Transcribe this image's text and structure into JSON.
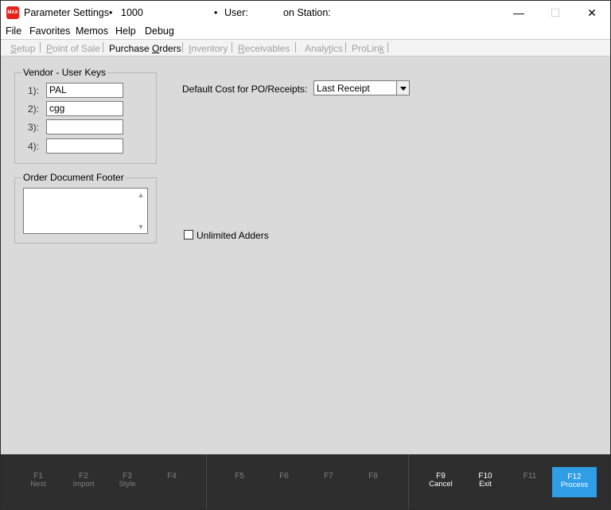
{
  "window": {
    "app_icon": "MAX",
    "title": "Parameter Settings",
    "bullet1": "•",
    "store_number": "1000",
    "bullet2": "•",
    "user_label": "User:",
    "station_label": "on Station:",
    "controls": {
      "minimize": "—",
      "maximize": "☐",
      "close": "✕"
    }
  },
  "menu": [
    "File",
    "Favorites",
    "Memos",
    "Help",
    "Debug"
  ],
  "tabs": [
    {
      "pre": "",
      "u": "S",
      "post": "etup",
      "active": false
    },
    {
      "pre": "",
      "u": "P",
      "post": "oint of Sale",
      "active": false
    },
    {
      "pre": "Purchase ",
      "u": "O",
      "post": "rders",
      "active": true
    },
    {
      "pre": "",
      "u": "I",
      "post": "nventory",
      "active": false
    },
    {
      "pre": "",
      "u": "R",
      "post": "eceivables",
      "active": false
    },
    {
      "pre": "Analy",
      "u": "t",
      "post": "ics",
      "active": false
    },
    {
      "pre": "ProLin",
      "u": "k",
      "post": "",
      "active": false
    }
  ],
  "vendor_keys": {
    "title": "Vendor - User Keys",
    "items": [
      {
        "label": "1):",
        "value": "PAL"
      },
      {
        "label": "2):",
        "value": "cgg"
      },
      {
        "label": "3):",
        "value": ""
      },
      {
        "label": "4):",
        "value": ""
      }
    ]
  },
  "footer": {
    "title": "Order Document Footer",
    "value": ""
  },
  "default_cost": {
    "label": "Default Cost for PO/Receipts:",
    "value": "Last Receipt"
  },
  "unlimited_adders": {
    "label": "Unlimited Adders",
    "checked": false
  },
  "function_keys": [
    {
      "key": "F1",
      "action": "Next",
      "enabled": false
    },
    {
      "key": "F2",
      "action": "Import",
      "enabled": false
    },
    {
      "key": "F3",
      "action": "Style",
      "enabled": false
    },
    {
      "key": "F4",
      "action": "",
      "enabled": false
    },
    {
      "key": "F5",
      "action": "",
      "enabled": false
    },
    {
      "key": "F6",
      "action": "",
      "enabled": false
    },
    {
      "key": "F7",
      "action": "",
      "enabled": false
    },
    {
      "key": "F8",
      "action": "",
      "enabled": false
    },
    {
      "key": "F9",
      "action": "Cancel",
      "enabled": true
    },
    {
      "key": "F10",
      "action": "Exit",
      "enabled": true
    },
    {
      "key": "F11",
      "action": "",
      "enabled": false
    },
    {
      "key": "F12",
      "action": "Process",
      "enabled": true
    }
  ],
  "colors": {
    "accent": "#2f9ee6",
    "app_icon": "#e2231a",
    "fkey_bar": "#2e2e2e",
    "background": "#dadada"
  }
}
